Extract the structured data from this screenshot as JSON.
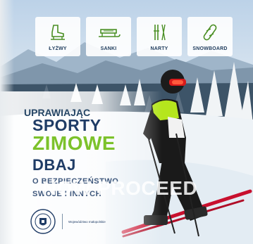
{
  "categories": [
    {
      "label": "ŁYŻWY",
      "icon": "ice-skate-icon"
    },
    {
      "label": "SANKI",
      "icon": "sled-icon"
    },
    {
      "label": "NARTY",
      "icon": "skis-icon"
    },
    {
      "label": "SNOWBOARD",
      "icon": "snowboard-icon"
    }
  ],
  "headline": {
    "line1": "UPRAWIAJĄC",
    "line2": "SPORTY",
    "line3": "ZIMOWE",
    "line4": "DBAJ",
    "line5": "O BEZPIECZEŃSTWO",
    "line6": "SWOJE I INNYCH"
  },
  "overlay_text": "NOW PROCEED",
  "logos": {
    "seal_text": "PREZYDENT RZECZYPOSPOLITEJ",
    "partner_label": "Województwo małopolskie"
  },
  "colors": {
    "navy": "#1f3c66",
    "green": "#7cc22b",
    "jacket_green": "#b5e61d"
  }
}
